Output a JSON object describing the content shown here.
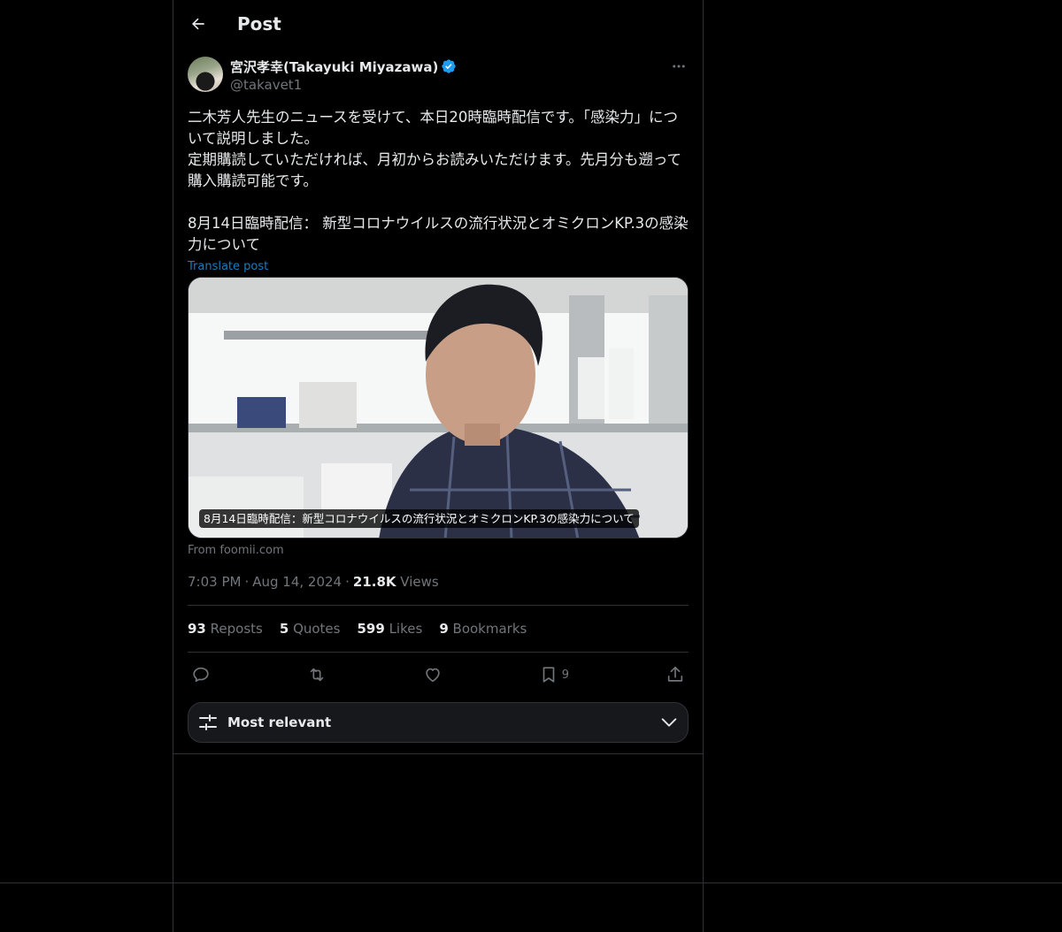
{
  "header": {
    "title": "Post"
  },
  "post": {
    "author": {
      "display_name": "宮沢孝幸(Takayuki Miyazawa)",
      "handle": "@takavet1"
    },
    "text": "二木芳人先生のニュースを受けて、本日20時臨時配信です。「感染力」について説明しました。\n定期購読していただければ、月初からお読みいただけます。先月分も遡って購入購読可能です。\n\n8月14日臨時配信： 新型コロナウイルスの流行状況とオミクロンKP.3の感染力について",
    "translate_label": "Translate post",
    "media_caption": "8月14日臨時配信：新型コロナウイルスの流行状況とオミクロンKP.3の感染力について",
    "source": "From foomii.com",
    "time": "7:03 PM",
    "date": "Aug 14, 2024",
    "views_count": "21.8K",
    "views_label": "Views",
    "stats": {
      "reposts_count": "93",
      "reposts_label": "Reposts",
      "quotes_count": "5",
      "quotes_label": "Quotes",
      "likes_count": "599",
      "likes_label": "Likes",
      "bookmarks_count": "9",
      "bookmarks_label": "Bookmarks"
    },
    "actions": {
      "bookmark_count": "9"
    }
  },
  "sort": {
    "label": "Most relevant"
  },
  "colors": {
    "accent": "#1d9bf0",
    "background": "#000000",
    "border": "#2f3336",
    "muted": "#71767b"
  }
}
